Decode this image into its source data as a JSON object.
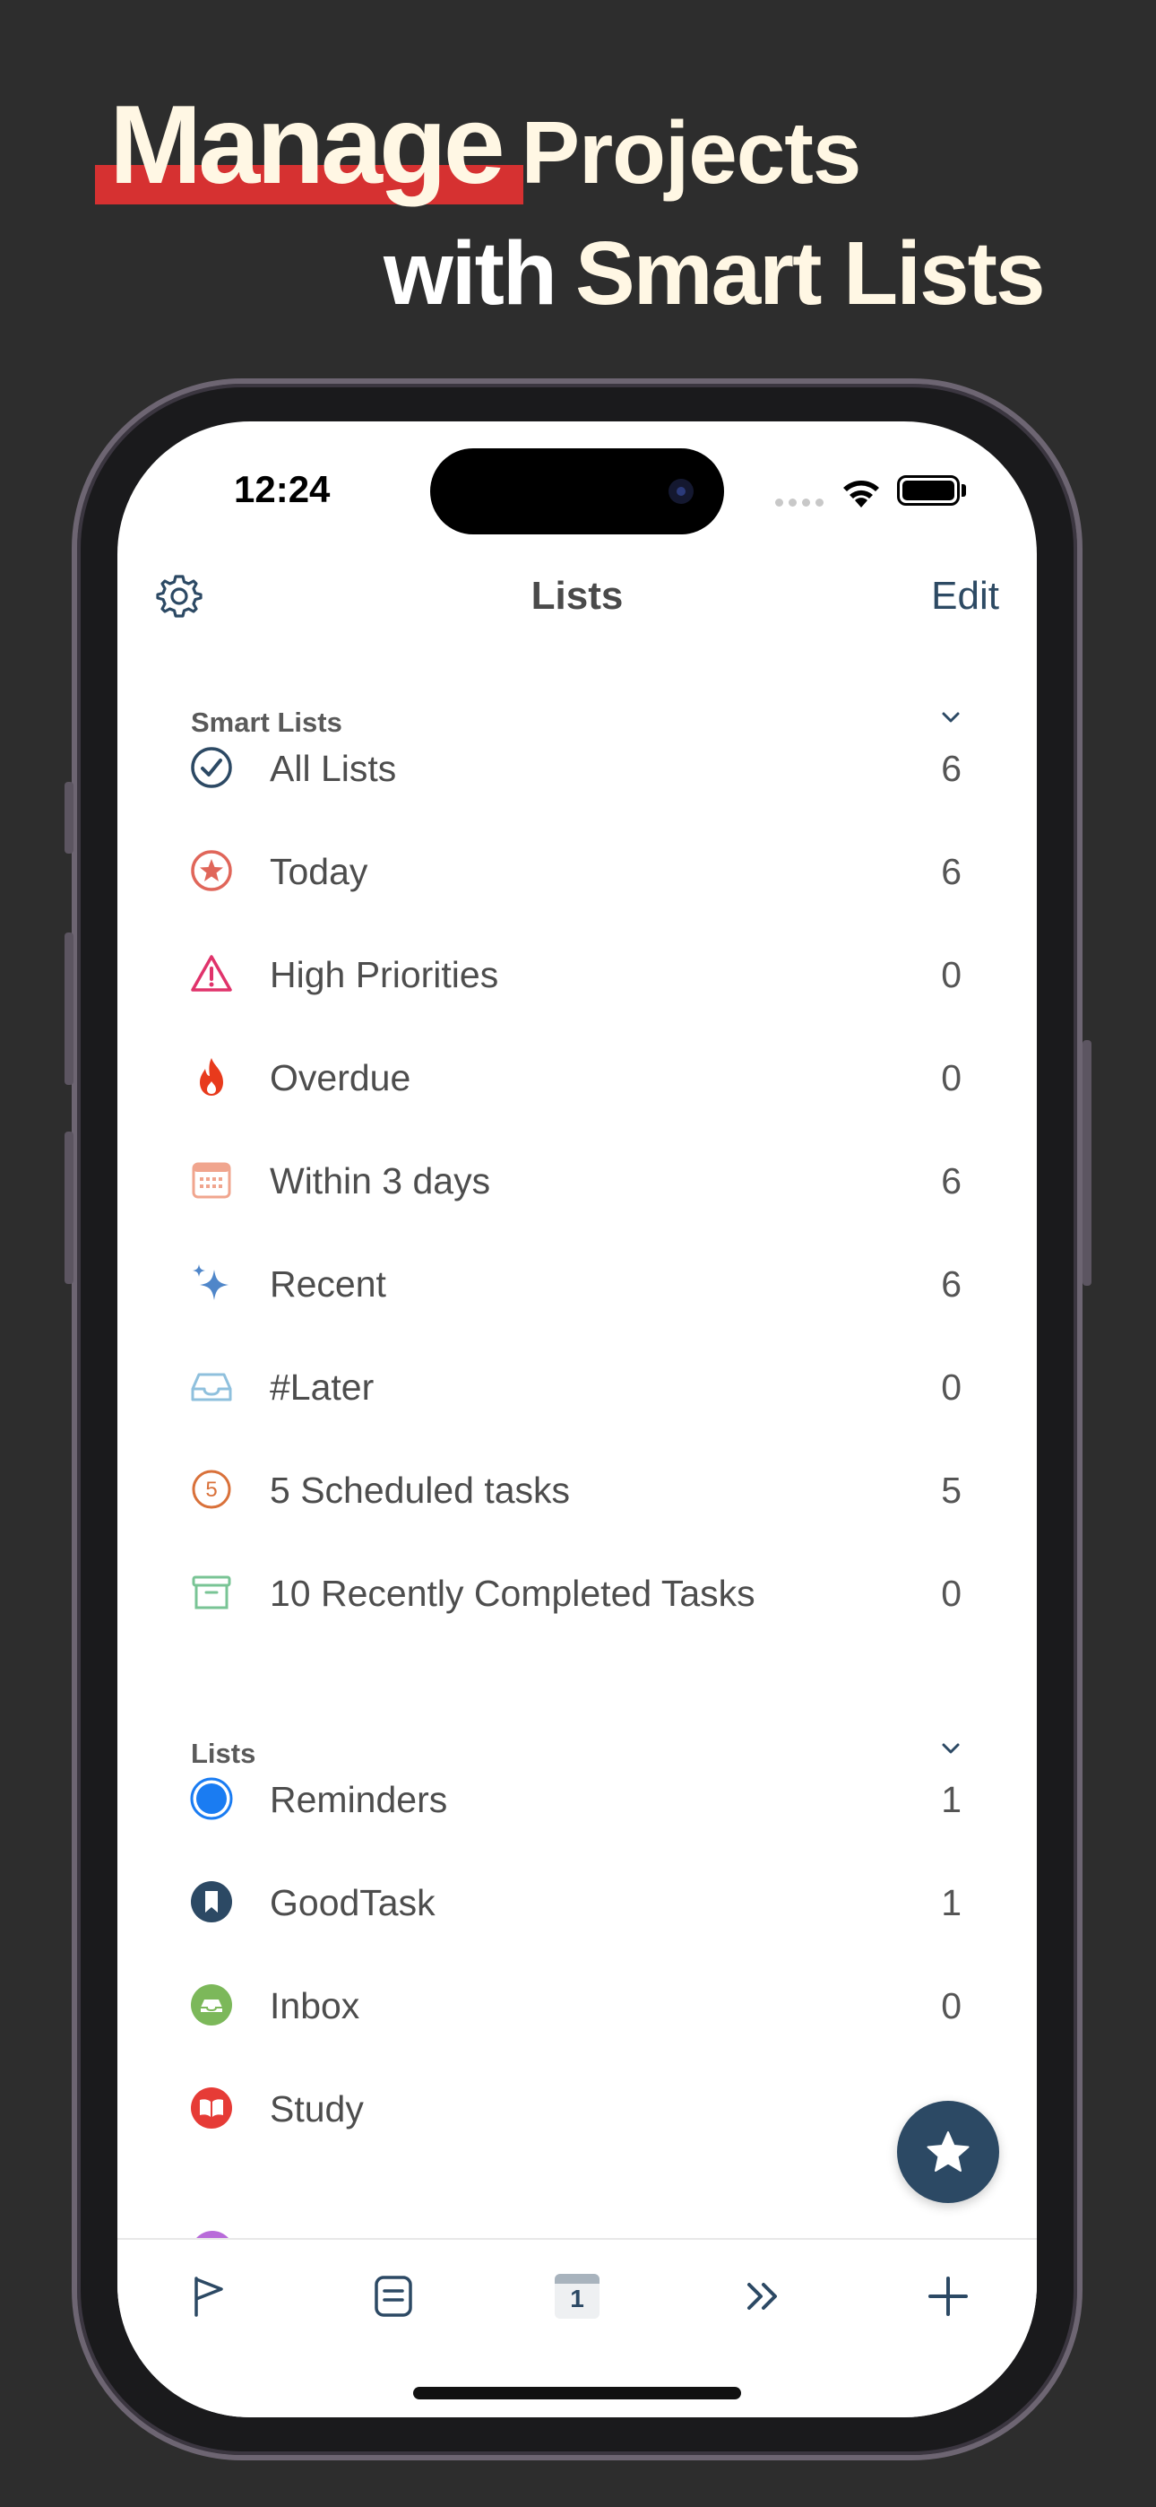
{
  "headline": {
    "word_highlight": "Manage",
    "word_after": "Projects",
    "line2_a": "with",
    "line2_b": "Smart Lists"
  },
  "status_bar": {
    "time": "12:24"
  },
  "nav": {
    "title": "Lists",
    "edit_label": "Edit",
    "settings_icon": "gear-icon"
  },
  "smart_lists": {
    "header": "Smart Lists",
    "items": [
      {
        "label": "All Lists",
        "count": "6",
        "icon": "checkmark-circle-icon",
        "color": "#2c4964"
      },
      {
        "label": "Today",
        "count": "6",
        "icon": "star-circle-icon",
        "color": "#e0665a"
      },
      {
        "label": "High Priorities",
        "count": "0",
        "icon": "warning-triangle-icon",
        "color": "#e0336b"
      },
      {
        "label": "Overdue",
        "count": "0",
        "icon": "flame-icon",
        "color": "#e83a1c"
      },
      {
        "label": "Within 3 days",
        "count": "6",
        "icon": "calendar-grid-icon",
        "color": "#f0a58e"
      },
      {
        "label": "Recent",
        "count": "6",
        "icon": "sparkles-icon",
        "color": "#4f86c9"
      },
      {
        "label": "#Later",
        "count": "0",
        "icon": "tray-icon",
        "color": "#8fc0dd"
      },
      {
        "label": "5 Scheduled tasks",
        "count": "5",
        "icon": "number-5-circle-icon",
        "color": "#d9713a"
      },
      {
        "label": "10 Recently Completed Tasks",
        "count": "0",
        "icon": "archive-box-icon",
        "color": "#79c495"
      }
    ]
  },
  "lists": {
    "header": "Lists",
    "items": [
      {
        "label": "Reminders",
        "count": "1",
        "icon": "filled-circle-icon",
        "color": "#1a7cf2"
      },
      {
        "label": "GoodTask",
        "count": "1",
        "icon": "bookmark-circle-icon",
        "color": "#2c4964"
      },
      {
        "label": "Inbox",
        "count": "0",
        "icon": "tray-circle-icon",
        "color": "#7cb85a"
      },
      {
        "label": "Study",
        "count": "",
        "icon": "book-circle-icon",
        "color": "#e63b36"
      }
    ]
  },
  "tabbar": {
    "calendar_day": "1",
    "icons": [
      "flag-icon",
      "list-icon",
      "calendar-icon",
      "forward-icon",
      "plus-icon"
    ]
  },
  "colors": {
    "accent": "#2c4964",
    "headline_highlight": "#d63131",
    "background": "#2d2d2d"
  }
}
